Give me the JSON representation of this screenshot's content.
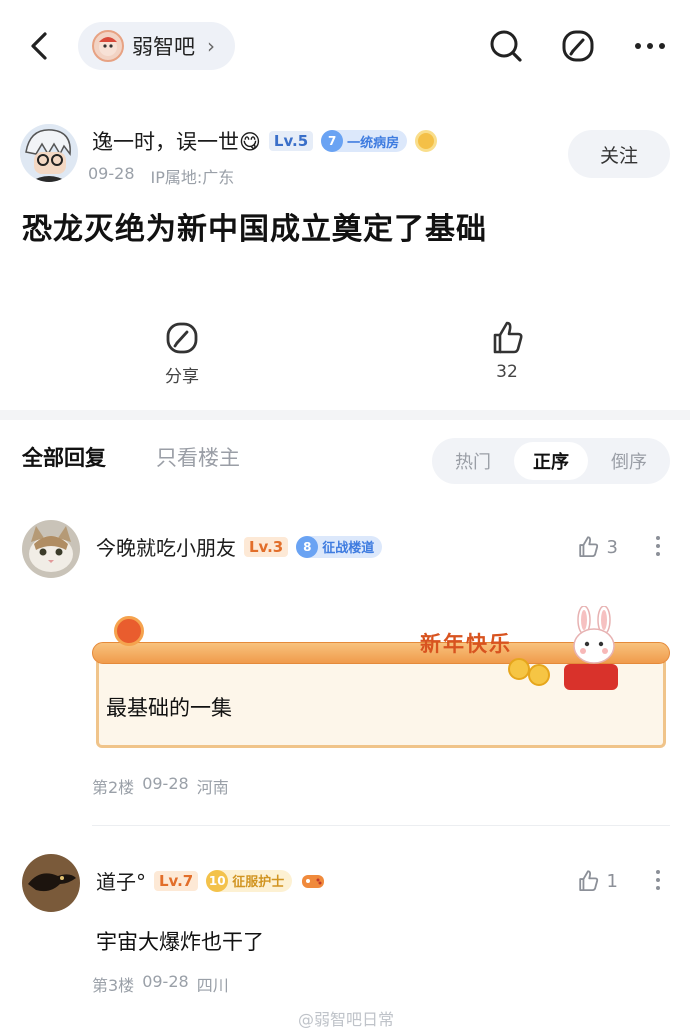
{
  "header": {
    "forum_name": "弱智吧",
    "chevron": "›",
    "icons": [
      "back-icon",
      "search-icon",
      "edit-icon",
      "more-icon"
    ]
  },
  "post": {
    "author": "逸一时，误一世😋",
    "level": "Lv.5",
    "badge_num": "7",
    "badge_title": "一统病房",
    "date": "09-28",
    "ip": "IP属地:广东",
    "follow_label": "关注",
    "title": "恐龙灭绝为新中国成立奠定了基础",
    "share_label": "分享",
    "like_count": "32"
  },
  "tabs": {
    "all": "全部回复",
    "owner_only": "只看楼主",
    "sort": [
      "热门",
      "正序",
      "倒序"
    ],
    "active_sort": "正序"
  },
  "comments": [
    {
      "name": "今晚就吃小朋友",
      "level": "Lv.3",
      "badge_num": "8",
      "badge_title": "征战楼道",
      "likes": "3",
      "text": "最基础的一集",
      "card_greeting": "新年快乐",
      "floor": "第2楼",
      "date": "09-28",
      "location": "河南"
    },
    {
      "name": "道子°",
      "level": "Lv.7",
      "badge_num": "10",
      "badge_title": "征服护士",
      "likes": "1",
      "text": "宇宙大爆炸也干了",
      "floor": "第3楼",
      "date": "09-28",
      "location": "四川"
    }
  ],
  "watermark": "@弱智吧日常",
  "colors": {
    "accent_blue": "#3f7ce0",
    "level_orange": "#e26e2a",
    "greeting_red": "#d8531f",
    "meta_gray": "#9aa0a8"
  }
}
